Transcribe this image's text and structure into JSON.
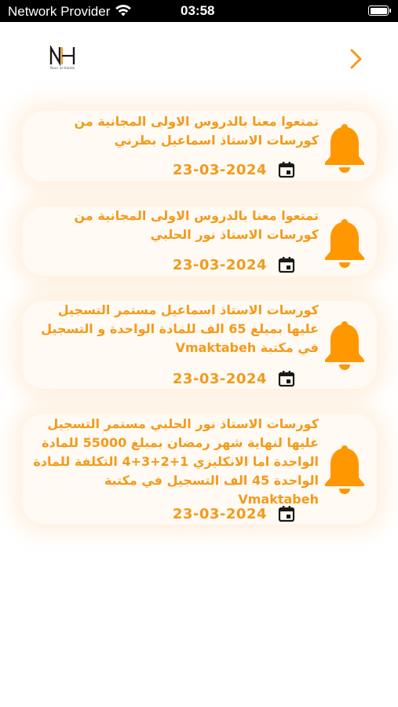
{
  "status_bar": {
    "carrier": "Network Provider",
    "time": "03:58"
  },
  "header": {
    "logo_letters": "NH",
    "logo_tagline": "Nour al-Halabi"
  },
  "colors": {
    "accent": "#f39a1b",
    "bell": "#ff9800",
    "card_bg": "#fffaf3"
  },
  "notifications": [
    {
      "message": "تمتعوا معنا بالدروس الاولى المجانية من كورسات الاستاذ اسماعيل بطرني",
      "date": "23-03-2024"
    },
    {
      "message": "تمتعوا معنا بالدروس الاولى المجانية من كورسات الاستاذ نور الحلبي",
      "date": "23-03-2024"
    },
    {
      "message": "كورسات الاستاذ اسماعيل مستمر التسجيل عليها بمبلغ 65 الف للمادة الواحدة و التسجيل في مكتبة Vmaktabeh",
      "date": "23-03-2024"
    },
    {
      "message": "كورسات الاستاذ نور الحلبي مستمر التسجيل عليها لنهاية شهر رمضان بمبلغ 55000 للمادة الواحدة اما الانكليزي 1+2+3+4 التكلفة للمادة الواحدة 45 الف التسجيل في مكتبة Vmaktabeh",
      "date": "23-03-2024"
    }
  ]
}
